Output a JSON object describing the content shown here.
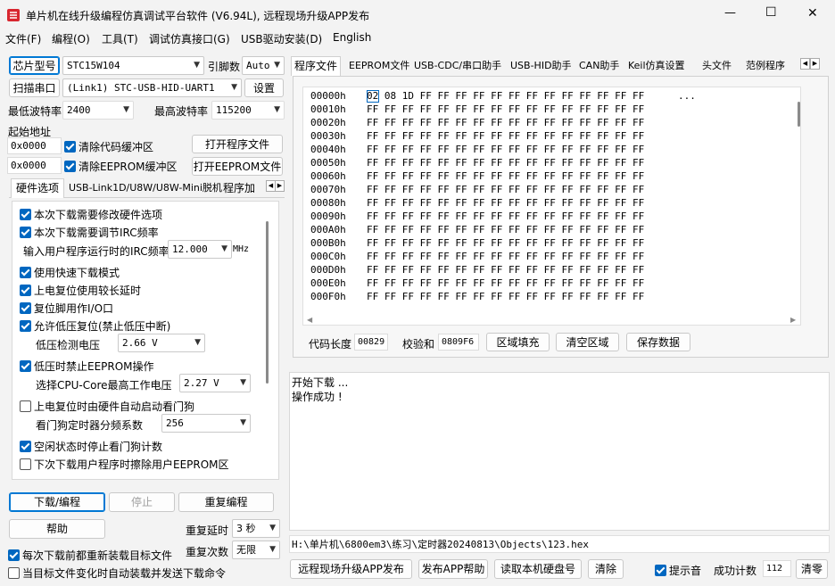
{
  "window": {
    "title": "单片机在线升级编程仿真调试平台软件 (V6.94L), 远程现场升级APP发布",
    "controls": {
      "minimize": "—",
      "maximize": "☐",
      "close": "✕"
    }
  },
  "menu": [
    "文件(F)",
    "编程(O)",
    "工具(T)",
    "调试仿真接口(G)",
    "USB驱动安装(D)",
    "English"
  ],
  "left": {
    "chip_button": "芯片型号",
    "chip_value": "STC15W104",
    "pin_label": "引脚数",
    "pin_value": "Auto",
    "scan_button": "扫描串口",
    "port_value": "(Link1) STC-USB-HID-UART1",
    "settings_button": "设置",
    "min_baud_label": "最低波特率",
    "min_baud_value": "2400",
    "max_baud_label": "最高波特率",
    "max_baud_value": "115200",
    "start_addr_label": "起始地址",
    "addr1": "0x0000",
    "clear_code_label": "清除代码缓冲区",
    "open_prog_button": "打开程序文件",
    "addr2": "0x0000",
    "clear_eeprom_label": "清除EEPROM缓冲区",
    "open_eeprom_button": "打开EEPROM文件",
    "tabs": [
      "硬件选项",
      "USB-Link1D/U8W/U8W-Mini脱机",
      "程序加"
    ],
    "options": {
      "opt1": "本次下载需要修改硬件选项",
      "opt2": "本次下载需要调节IRC频率",
      "irc_label": "输入用户程序运行时的IRC频率",
      "irc_value": "12.000",
      "irc_unit": "MHz",
      "opt3": "使用快速下载模式",
      "opt4": "上电复位使用较长延时",
      "opt5": "复位脚用作I/O口",
      "opt6": "允许低压复位(禁止低压中断)",
      "lv_label": "低压检测电压",
      "lv_value": "2.66 V",
      "opt7": "低压时禁止EEPROM操作",
      "cpu_label": "选择CPU-Core最高工作电压",
      "cpu_value": "2.27 V",
      "opt8": "上电复位时由硬件自动启动看门狗",
      "wdt_label": "看门狗定时器分频系数",
      "wdt_value": "256",
      "opt9": "空闲状态时停止看门狗计数",
      "opt10": "下次下载用户程序时擦除用户EEPROM区"
    },
    "download_button": "下载/编程",
    "stop_button": "停止",
    "reprogram_button": "重复编程",
    "help_button": "帮助",
    "repeat_delay_label": "重复延时",
    "repeat_delay_value": "3 秒",
    "repeat_count_label": "重复次数",
    "repeat_count_value": "无限",
    "reload_label": "每次下载前都重新装载目标文件",
    "auto_load_label": "当目标文件变化时自动装载并发送下载命令"
  },
  "right": {
    "tabs": [
      "程序文件",
      "EEPROM文件",
      "USB-CDC/串口助手",
      "USB-HID助手",
      "CAN助手",
      "Keil仿真设置",
      "头文件",
      "范例程序"
    ],
    "hex_rows": [
      {
        "addr": "00000h",
        "bytes": "02 08 1D FF FF FF FF FF FF FF FF FF FF FF FF FF",
        "ascii": "..."
      },
      {
        "addr": "00010h",
        "bytes": "FF FF FF FF FF FF FF FF FF FF FF FF FF FF FF FF",
        "ascii": ""
      },
      {
        "addr": "00020h",
        "bytes": "FF FF FF FF FF FF FF FF FF FF FF FF FF FF FF FF",
        "ascii": ""
      },
      {
        "addr": "00030h",
        "bytes": "FF FF FF FF FF FF FF FF FF FF FF FF FF FF FF FF",
        "ascii": ""
      },
      {
        "addr": "00040h",
        "bytes": "FF FF FF FF FF FF FF FF FF FF FF FF FF FF FF FF",
        "ascii": ""
      },
      {
        "addr": "00050h",
        "bytes": "FF FF FF FF FF FF FF FF FF FF FF FF FF FF FF FF",
        "ascii": ""
      },
      {
        "addr": "00060h",
        "bytes": "FF FF FF FF FF FF FF FF FF FF FF FF FF FF FF FF",
        "ascii": ""
      },
      {
        "addr": "00070h",
        "bytes": "FF FF FF FF FF FF FF FF FF FF FF FF FF FF FF FF",
        "ascii": ""
      },
      {
        "addr": "00080h",
        "bytes": "FF FF FF FF FF FF FF FF FF FF FF FF FF FF FF FF",
        "ascii": ""
      },
      {
        "addr": "00090h",
        "bytes": "FF FF FF FF FF FF FF FF FF FF FF FF FF FF FF FF",
        "ascii": ""
      },
      {
        "addr": "000A0h",
        "bytes": "FF FF FF FF FF FF FF FF FF FF FF FF FF FF FF FF",
        "ascii": ""
      },
      {
        "addr": "000B0h",
        "bytes": "FF FF FF FF FF FF FF FF FF FF FF FF FF FF FF FF",
        "ascii": ""
      },
      {
        "addr": "000C0h",
        "bytes": "FF FF FF FF FF FF FF FF FF FF FF FF FF FF FF FF",
        "ascii": ""
      },
      {
        "addr": "000D0h",
        "bytes": "FF FF FF FF FF FF FF FF FF FF FF FF FF FF FF FF",
        "ascii": ""
      },
      {
        "addr": "000E0h",
        "bytes": "FF FF FF FF FF FF FF FF FF FF FF FF FF FF FF FF",
        "ascii": ""
      },
      {
        "addr": "000F0h",
        "bytes": "FF FF FF FF FF FF FF FF FF FF FF FF FF FF FF FF",
        "ascii": ""
      }
    ],
    "code_len_label": "代码长度",
    "code_len_value": "00829",
    "checksum_label": "校验和",
    "checksum_value": "0809F6",
    "fill_button": "区域填充",
    "clear_button": "清空区域",
    "save_button": "保存数据",
    "log": [
      "开始下载 ...",
      "操作成功 !"
    ],
    "file_path": "H:\\单片机\\6800em3\\练习\\定时器20240813\\Objects\\123.hex",
    "publish_button": "远程现场升级APP发布",
    "publish_help_button": "发布APP帮助",
    "read_disk_button": "读取本机硬盘号",
    "clear_log_button": "清除",
    "beep_label": "提示音",
    "success_label": "成功计数",
    "success_value": "112",
    "clear_count_button": "清零"
  },
  "colors": {
    "accent": "#0067c0",
    "window_bg": "#f3f3f3"
  }
}
